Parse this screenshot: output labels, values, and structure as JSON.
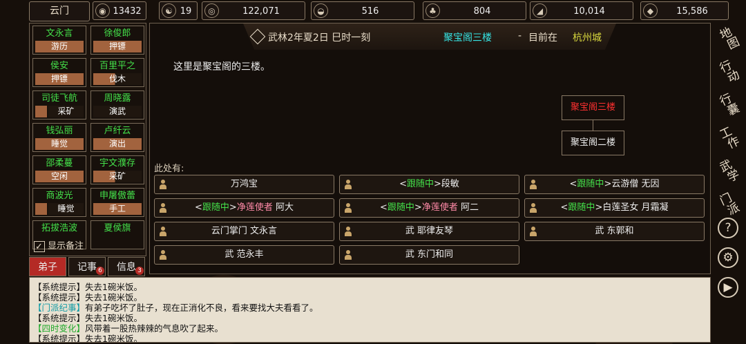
{
  "topbar": {
    "sect_name": "云门",
    "resources": [
      {
        "icon": "coin-pouch-icon",
        "glyph": "◉",
        "value": "13432"
      },
      {
        "icon": "yin-yang-icon",
        "glyph": "☯",
        "value": "19"
      },
      {
        "icon": "copper-coin-icon",
        "glyph": "◎",
        "value": "122,071"
      },
      {
        "icon": "rice-bowl-icon",
        "glyph": "◒",
        "value": "516"
      },
      {
        "icon": "herb-icon",
        "glyph": "♣",
        "value": "804"
      },
      {
        "icon": "wood-log-icon",
        "glyph": "◢",
        "value": "10,014"
      },
      {
        "icon": "ore-icon",
        "glyph": "◆",
        "value": "15,586"
      }
    ]
  },
  "disciples": [
    {
      "name": "文永言",
      "job": "游历",
      "style": "full"
    },
    {
      "name": "徐俊郎",
      "job": "押镖",
      "style": "full"
    },
    {
      "name": "侯安",
      "job": "押镖",
      "style": "full"
    },
    {
      "name": "百里平之",
      "job": "伐木",
      "style": "partial"
    },
    {
      "name": "司徒飞航",
      "job": "采矿",
      "style": "mark"
    },
    {
      "name": "周晓露",
      "job": "演武",
      "style": "dark"
    },
    {
      "name": "钱弘丽",
      "job": "睡觉",
      "style": "full"
    },
    {
      "name": "卢纤云",
      "job": "演出",
      "style": "full"
    },
    {
      "name": "邵柔蔓",
      "job": "空闲",
      "style": "full"
    },
    {
      "name": "宇文濮存",
      "job": "采矿",
      "style": "partial"
    },
    {
      "name": "商波光",
      "job": "睡觉",
      "style": "mark"
    },
    {
      "name": "申屠傲蕾",
      "job": "手工",
      "style": "full"
    },
    {
      "name": "拓拔浩波",
      "job": "",
      "style": "cut"
    },
    {
      "name": "夏侯旗",
      "job": "",
      "style": "cut"
    }
  ],
  "notes_toggle": "显示备注",
  "tabs": [
    {
      "label": "弟子",
      "badge": ""
    },
    {
      "label": "记事",
      "badge": "6"
    },
    {
      "label": "信息",
      "badge": "3"
    }
  ],
  "header": {
    "date": "武林2年夏2日 巳时一刻",
    "location": "聚宝阁三楼",
    "separator": "-",
    "prefix": "目前在",
    "city": "杭州城"
  },
  "description": "这里是聚宝阁的三楼。",
  "minimap": {
    "current": "聚宝阁三楼",
    "below": "聚宝阁二楼"
  },
  "here_label": "此处有:",
  "npcs": [
    {
      "pre": "",
      "tag": "",
      "faction": "",
      "name": "万鸿宝"
    },
    {
      "pre": "<",
      "tag": "跟随中",
      "post": ">",
      "faction": "",
      "name": "段敏"
    },
    {
      "pre": "<",
      "tag": "跟随中",
      "post": ">",
      "faction": "",
      "name": "云游僧 无因"
    },
    {
      "pre": "<",
      "tag": "跟随中",
      "post": ">",
      "faction": "净莲使者",
      "name": " 阿大"
    },
    {
      "pre": "<",
      "tag": "跟随中",
      "post": ">",
      "faction": "净莲使者",
      "name": " 阿二"
    },
    {
      "pre": "<",
      "tag": "跟随中",
      "post": ">",
      "faction": "",
      "name": "白莲圣女 月霜凝"
    },
    {
      "pre": "",
      "tag": "",
      "faction": "",
      "name": "云门掌门 文永言"
    },
    {
      "pre": "",
      "tag": "",
      "faction": "",
      "name": "武 耶律友琴"
    },
    {
      "pre": "",
      "tag": "",
      "faction": "",
      "name": "武 东郭和"
    },
    {
      "pre": "",
      "tag": "",
      "faction": "",
      "name": "武 范永丰"
    },
    {
      "pre": "",
      "tag": "",
      "faction": "",
      "name": "武 东门和同"
    }
  ],
  "log": [
    {
      "tag": "【系统提示】",
      "color": "dark",
      "text": "失去1碗米饭。"
    },
    {
      "tag": "【系统提示】",
      "color": "dark",
      "text": "失去1碗米饭。"
    },
    {
      "tag": "【门派纪事】",
      "color": "cyan",
      "text": "有弟子吃坏了肚子，现在正消化不良，看来要找大夫看看了。"
    },
    {
      "tag": "【系统提示】",
      "color": "dark",
      "text": "失去1碗米饭。"
    },
    {
      "tag": "【四时变化】",
      "color": "green",
      "text": "风带着一股热辣辣的气息吹了起来。"
    },
    {
      "tag": "【系统提示】",
      "color": "dark",
      "text": "失去1碗米饭。"
    }
  ],
  "right_menu": [
    {
      "label": "地图",
      "name": "map-button"
    },
    {
      "label": "行动",
      "name": "action-button"
    },
    {
      "label": "行囊",
      "name": "bag-button"
    },
    {
      "label": "工作",
      "name": "work-button"
    },
    {
      "label": "武学",
      "name": "martial-arts-button"
    },
    {
      "label": "门派",
      "name": "sect-button"
    }
  ],
  "right_icons": [
    {
      "name": "help-icon",
      "glyph": "?"
    },
    {
      "name": "settings-gear-icon",
      "glyph": "⚙"
    },
    {
      "name": "play-icon",
      "glyph": "▶"
    }
  ]
}
